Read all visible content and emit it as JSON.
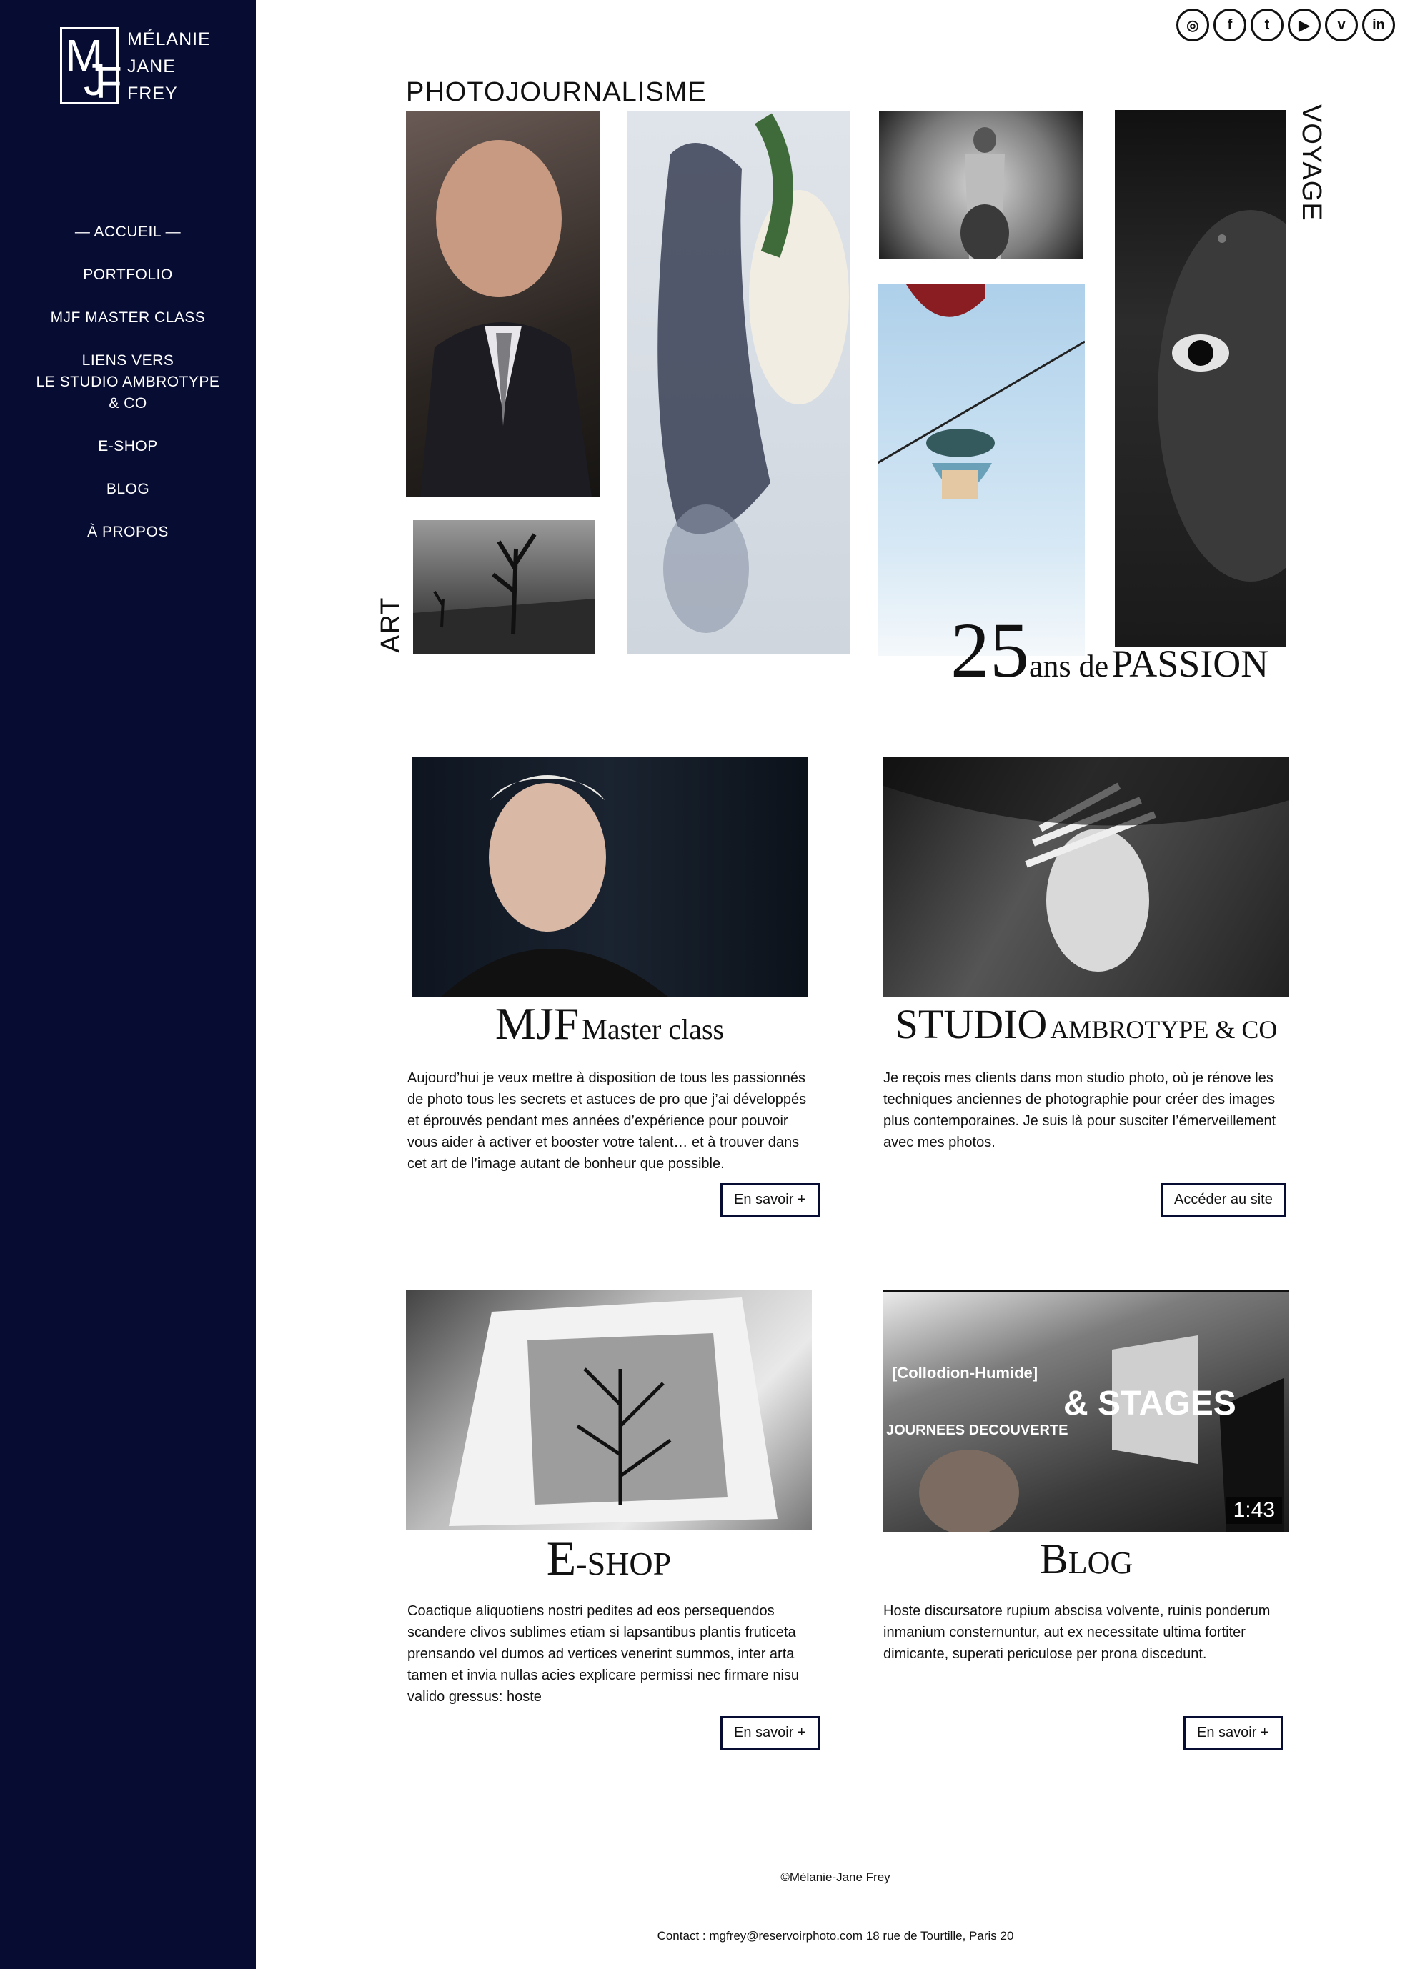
{
  "brand": {
    "monogram": "MJF",
    "name_lines": [
      "MÉLANIE",
      "JANE",
      "FREY"
    ]
  },
  "nav": {
    "items": [
      {
        "label": "— ACCUEIL —",
        "active": true
      },
      {
        "label": "PORTFOLIO"
      },
      {
        "label": "MJF MASTER CLASS"
      },
      {
        "label_lines": [
          "LIENS VERS",
          "LE STUDIO AMBROTYPE",
          "& CO"
        ]
      },
      {
        "label": "E-SHOP"
      },
      {
        "label": "BLOG"
      },
      {
        "label": "À PROPOS"
      }
    ]
  },
  "social": {
    "icons": [
      {
        "name": "instagram-icon",
        "glyph": "◎"
      },
      {
        "name": "facebook-icon",
        "glyph": "f"
      },
      {
        "name": "twitter-icon",
        "glyph": "t"
      },
      {
        "name": "youtube-icon",
        "glyph": "▶"
      },
      {
        "name": "vimeo-icon",
        "glyph": "v"
      },
      {
        "name": "linkedin-icon",
        "glyph": "in"
      }
    ]
  },
  "hero": {
    "label_top": "PHOTOJOURNALISME",
    "label_art": "ART",
    "label_voyage": "VOYAGE",
    "passion": {
      "number": "25",
      "middle": "ans de",
      "word": "PASSION"
    }
  },
  "cards": {
    "masterclass": {
      "title_big": "MJF",
      "title_small": "Master class",
      "text": "Aujourd’hui je veux mettre à disposition de tous les passionnés de photo tous les secrets et astuces de pro que j’ai développés et éprouvés pendant mes années d’expérience pour pouvoir vous aider à activer et booster votre talent… et à trouver dans cet art de l’image autant de bonheur que possible.",
      "button": "En savoir +"
    },
    "studio": {
      "title_big": "STUDIO",
      "title_small": "AMBROTYPE & CO",
      "text": "Je reçois mes clients dans mon studio photo, où je rénove les techniques anciennes de photographie pour créer des images plus contemporaines. Je suis là pour susciter l’émerveillement avec mes photos.",
      "button": "Accéder au site"
    },
    "eshop": {
      "title_big": "E",
      "title_small": "-SHOP",
      "text": "Coactique aliquotiens nostri pedites ad eos persequendos scandere clivos sublimes etiam si lapsantibus plantis fruticeta prensando vel dumos ad vertices venerint summos, inter arta tamen et invia nullas acies explicare permissi nec firmare nisu valido gressus: hoste",
      "button": "En savoir +"
    },
    "blog": {
      "title_big": "B",
      "title_small": "LOG",
      "text": "Hoste discursatore rupium abscisa volvente, ruinis ponderum inmanium consternuntur, aut ex necessitate ultima fortiter dimicante, superati periculose per prona discedunt.",
      "button": "En savoir +",
      "video": {
        "tag": "[Collodion-Humide]",
        "headline": "& STAGES",
        "subline": "JOURNEES DECOUVERTE",
        "duration": "1:43"
      }
    }
  },
  "footer": {
    "copyright": "©Mélanie-Jane Frey",
    "contact": "Contact : mgfrey@reservoirphoto.com 18 rue de Tourtille, Paris 20"
  }
}
